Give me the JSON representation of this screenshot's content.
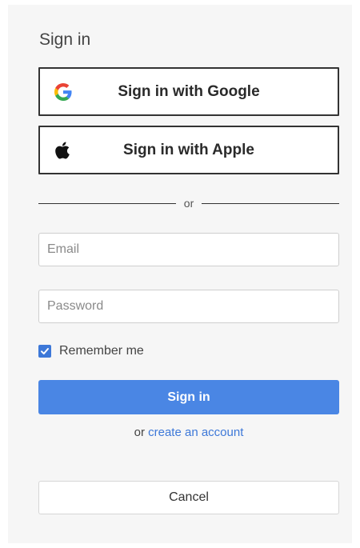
{
  "form": {
    "title": "Sign in",
    "google_button": {
      "label": "Sign in with Google",
      "icon": "google-icon"
    },
    "apple_button": {
      "label": "Sign in with Apple",
      "icon": "apple-icon"
    },
    "divider_text": "or",
    "email": {
      "placeholder": "Email",
      "value": ""
    },
    "password": {
      "placeholder": "Password",
      "value": ""
    },
    "remember": {
      "label": "Remember me",
      "checked": true
    },
    "submit_label": "Sign in",
    "create_prefix": "or",
    "create_link": "create an account",
    "cancel_label": "Cancel"
  },
  "colors": {
    "accent": "#4a86e4",
    "link": "#3d78d8",
    "panel_bg": "#f6f6f6"
  }
}
